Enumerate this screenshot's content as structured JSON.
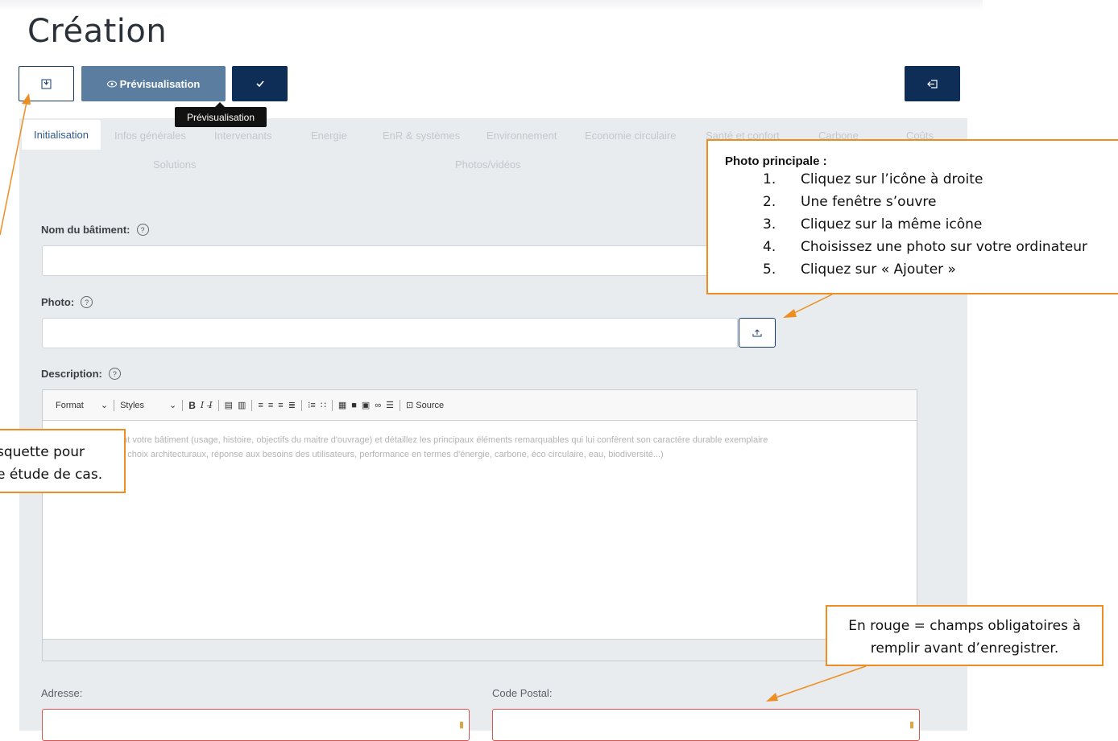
{
  "page": {
    "title": "Création"
  },
  "toolbar": {
    "preview_label": "Prévisualisation",
    "tooltip": "Prévisualisation"
  },
  "tabs": [
    {
      "label": "Initialisation",
      "active": true
    },
    {
      "label": "Infos générales"
    },
    {
      "label": "Intervenants"
    },
    {
      "label": "Energie"
    },
    {
      "label": "EnR & systèmes"
    },
    {
      "label": "Environnement"
    },
    {
      "label": "Economie circulaire"
    },
    {
      "label": "Santé et confort"
    },
    {
      "label": "Carbone"
    },
    {
      "label": "Coûts"
    },
    {
      "label": "Solutions"
    },
    {
      "label": "Photos/vidéos"
    }
  ],
  "form": {
    "name_label": "Nom du bâtiment:",
    "photo_label": "Photo:",
    "description_label": "Description:",
    "address_label": "Adresse:",
    "postal_label": "Code Postal:",
    "help_glyph": "?"
  },
  "editor": {
    "format_label": "Format",
    "styles_label": "Styles",
    "source_label": "Source",
    "placeholder_line1": "Décrivez brièvement votre bâtiment (usage, histoire, objectifs du maitre d'ouvrage) et détaillez les principaux éléments remarquables qui lui confèrent son caractère durable exemplaire",
    "placeholder_line2": "(démarche globale, choix architecturaux, réponse aux besoins des utilisateurs, performance en termes d'énergie, carbone, éco circulaire, eau, biodiversité...)"
  },
  "annotations": {
    "photo_title": "Photo principale :",
    "photo_steps": [
      {
        "num": "1.",
        "text": "Cliquez sur l’icône à droite"
      },
      {
        "num": "2.",
        "text": "Une fenêtre s’ouvre"
      },
      {
        "num": "3.",
        "text": "Cliquez sur la même icône"
      },
      {
        "num": "4.",
        "text": "Choisissez une photo sur votre ordinateur"
      },
      {
        "num": "5.",
        "text": "Cliquez sur « Ajouter »"
      }
    ],
    "required_note": "En rouge = champs obligatoires à remplir avant d’enregistrer.",
    "save_note_line1": "squette pour",
    "save_note_line2": "e étude de cas."
  },
  "colors": {
    "navy": "#0f2e57",
    "preview_blue": "#5b7d9f",
    "callout_orange": "#ee8e22",
    "required_red": "#d9534f"
  },
  "icons": {
    "save": "floppy-disk-icon",
    "preview": "eye-icon",
    "validate": "check-icon",
    "exit": "exit-icon",
    "upload": "upload-icon",
    "help": "help-circle-icon"
  }
}
